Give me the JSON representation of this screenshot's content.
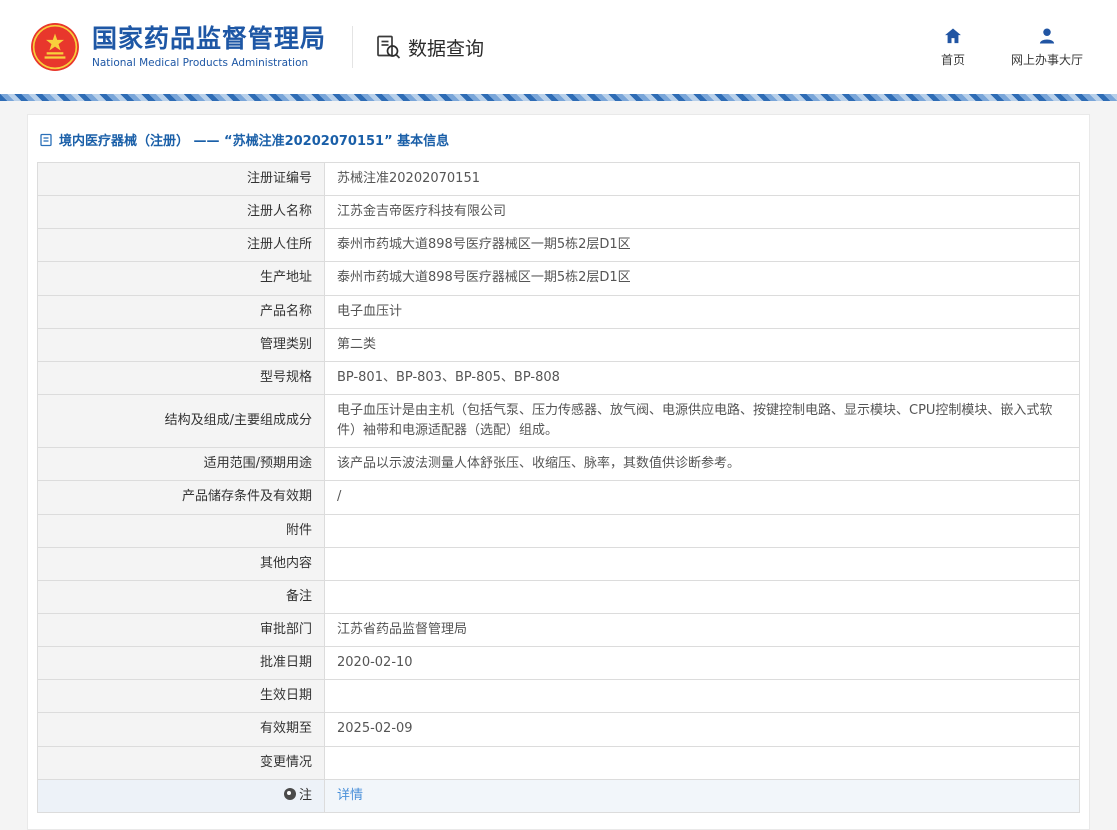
{
  "header": {
    "org_name_cn": "国家药品监督管理局",
    "org_name_en": "National Medical Products Administration",
    "query_title": "数据查询",
    "nav_home": "首页",
    "nav_hall": "网上办事大厅"
  },
  "page": {
    "breadcrumb": "境内医疗器械（注册） —— “苏械注准20202070151” 基本信息"
  },
  "colors": {
    "brand_blue": "#1e57a5",
    "link_blue": "#4a90d9",
    "emblem_red": "#e8372c",
    "emblem_gold": "#f8d03c"
  },
  "table": {
    "rows": [
      {
        "label": "注册证编号",
        "value": "苏械注准20202070151"
      },
      {
        "label": "注册人名称",
        "value": "江苏金吉帝医疗科技有限公司"
      },
      {
        "label": "注册人住所",
        "value": "泰州市药城大道898号医疗器械区一期5栋2层D1区"
      },
      {
        "label": "生产地址",
        "value": "泰州市药城大道898号医疗器械区一期5栋2层D1区"
      },
      {
        "label": "产品名称",
        "value": "电子血压计"
      },
      {
        "label": "管理类别",
        "value": "第二类"
      },
      {
        "label": "型号规格",
        "value": "BP-801、BP-803、BP-805、BP-808"
      },
      {
        "label": "结构及组成/主要组成成分",
        "value": "电子血压计是由主机（包括气泵、压力传感器、放气阀、电源供应电路、按键控制电路、显示模块、CPU控制模块、嵌入式软件）袖带和电源适配器（选配）组成。"
      },
      {
        "label": "适用范围/预期用途",
        "value": "该产品以示波法测量人体舒张压、收缩压、脉率，其数值供诊断参考。"
      },
      {
        "label": "产品储存条件及有效期",
        "value": "/"
      },
      {
        "label": "附件",
        "value": ""
      },
      {
        "label": "其他内容",
        "value": ""
      },
      {
        "label": "备注",
        "value": ""
      },
      {
        "label": "审批部门",
        "value": "江苏省药品监督管理局"
      },
      {
        "label": "批准日期",
        "value": "2020-02-10"
      },
      {
        "label": "生效日期",
        "value": ""
      },
      {
        "label": "有效期至",
        "value": "2025-02-09"
      },
      {
        "label": "变更情况",
        "value": ""
      },
      {
        "label": "注",
        "value": "详情",
        "link": true,
        "note_icon": true,
        "highlight": true
      }
    ]
  }
}
